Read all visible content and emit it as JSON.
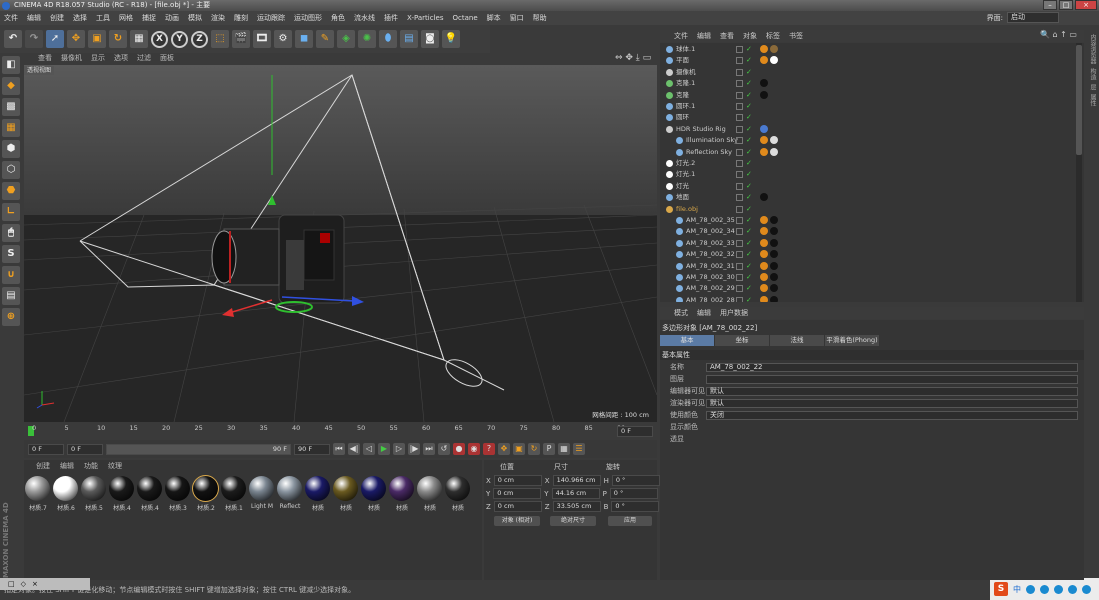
{
  "window": {
    "title": "CINEMA 4D R18.057 Studio (RC - R18) - [file.obj *] - 主要"
  },
  "menu": [
    "文件",
    "编辑",
    "创建",
    "选择",
    "工具",
    "网格",
    "捕捉",
    "动画",
    "模拟",
    "渲染",
    "雕刻",
    "运动跟踪",
    "运动图形",
    "角色",
    "流水线",
    "插件",
    "X-Particles",
    "Octane",
    "脚本",
    "窗口",
    "帮助"
  ],
  "layout": {
    "label": "界面:",
    "value": "启动"
  },
  "viewport": {
    "menu": [
      "查看",
      "摄像机",
      "显示",
      "选项",
      "过滤",
      "面板"
    ],
    "label": "透视视图",
    "grid_info": "网格间距 : 100 cm"
  },
  "timeline": {
    "ticks": [
      "0",
      "5",
      "10",
      "15",
      "20",
      "25",
      "30",
      "35",
      "40",
      "45",
      "50",
      "55",
      "60",
      "65",
      "70",
      "75",
      "80",
      "85",
      "90"
    ],
    "end_field": "0 F"
  },
  "playback": {
    "start": "0 F",
    "current": "0 F",
    "range_end": "90 F",
    "end": "90 F"
  },
  "materials": {
    "menu": [
      "创建",
      "编辑",
      "功能",
      "纹理"
    ],
    "items": [
      {
        "label": "材质.7",
        "color": "#9a9a9a"
      },
      {
        "label": "材质.6",
        "color": "#ffffff"
      },
      {
        "label": "材质.5",
        "color": "#5a5a5a"
      },
      {
        "label": "材质.4",
        "color": "#1a1a1a"
      },
      {
        "label": "材质.4",
        "color": "#1a1a1a"
      },
      {
        "label": "材质.3",
        "color": "#161616"
      },
      {
        "label": "材质.2",
        "color": "#121212"
      },
      {
        "label": "材质.1",
        "color": "#1c1c1c"
      },
      {
        "label": "Light M",
        "color": "#7a8590"
      },
      {
        "label": "Reflect",
        "color": "#8a95a0"
      },
      {
        "label": "材质",
        "color": "#1a1a66"
      },
      {
        "label": "材质",
        "color": "#6a5a20"
      },
      {
        "label": "材质",
        "color": "#1a1a66"
      },
      {
        "label": "材质",
        "color": "#4a2a66"
      },
      {
        "label": "材质",
        "color": "#8a8a8a"
      },
      {
        "label": "材质",
        "color": "#2e2e2e"
      }
    ]
  },
  "coords": {
    "headers": [
      "位置",
      "尺寸",
      "旋转"
    ],
    "rows": [
      {
        "axis": "X",
        "pos": "0 cm",
        "size": "140.966 cm",
        "rl": "H",
        "rot": "0 °"
      },
      {
        "axis": "Y",
        "pos": "0 cm",
        "size": "44.16 cm",
        "rl": "P",
        "rot": "0 °"
      },
      {
        "axis": "Z",
        "pos": "0 cm",
        "size": "33.505 cm",
        "rl": "B",
        "rot": "0 °"
      }
    ],
    "mode1": "对象 (相对)",
    "mode2": "绝对尺寸",
    "apply": "应用"
  },
  "object_manager": {
    "menu": [
      "文件",
      "编辑",
      "查看",
      "对象",
      "标签",
      "书签"
    ],
    "objects": [
      {
        "name": "球体.1",
        "color": "#7fb0e0",
        "tags": [
          "#e08a1c",
          "#8a6a3a"
        ]
      },
      {
        "name": "平面",
        "color": "#7fb0e0",
        "tags": [
          "#e08a1c",
          "#ffffff"
        ]
      },
      {
        "name": "摄像机",
        "color": "#cccccc",
        "tags": []
      },
      {
        "name": "克隆.1",
        "color": "#6cc06c",
        "tags": [
          "#111111"
        ]
      },
      {
        "name": "克隆",
        "color": "#6cc06c",
        "tags": [
          "#111111"
        ]
      },
      {
        "name": "圆环.1",
        "color": "#7fb0e0",
        "tags": []
      },
      {
        "name": "圆环",
        "color": "#7fb0e0",
        "tags": []
      },
      {
        "name": "HDR Studio Rig",
        "color": "#cccccc",
        "tags": [
          "#4a7ad0"
        ]
      },
      {
        "name": "Illumination Sky",
        "color": "#7fb0e0",
        "tags": [
          "#e08a1c",
          "#dddddd"
        ]
      },
      {
        "name": "Reflection Sky",
        "color": "#7fb0e0",
        "tags": [
          "#e08a1c",
          "#dddddd"
        ]
      },
      {
        "name": "灯光.2",
        "color": "#ffffff",
        "tags": []
      },
      {
        "name": "灯光.1",
        "color": "#ffffff",
        "tags": []
      },
      {
        "name": "灯光",
        "color": "#ffffff",
        "tags": []
      },
      {
        "name": "地面",
        "color": "#7fb0e0",
        "tags": [
          "#111111"
        ]
      },
      {
        "name": "file.obj",
        "color": "#d9a84a",
        "tags": []
      },
      {
        "name": "AM_78_002_35",
        "color": "#7fb0e0",
        "tags": [
          "#e08a1c",
          "#111111"
        ]
      },
      {
        "name": "AM_78_002_34",
        "color": "#7fb0e0",
        "tags": [
          "#e08a1c",
          "#111111"
        ]
      },
      {
        "name": "AM_78_002_33",
        "color": "#7fb0e0",
        "tags": [
          "#e08a1c",
          "#111111"
        ]
      },
      {
        "name": "AM_78_002_32",
        "color": "#7fb0e0",
        "tags": [
          "#e08a1c",
          "#111111"
        ]
      },
      {
        "name": "AM_78_002_31",
        "color": "#7fb0e0",
        "tags": [
          "#e08a1c",
          "#111111"
        ]
      },
      {
        "name": "AM_78_002_30",
        "color": "#7fb0e0",
        "tags": [
          "#e08a1c",
          "#111111"
        ]
      },
      {
        "name": "AM_78_002_29",
        "color": "#7fb0e0",
        "tags": [
          "#e08a1c",
          "#111111"
        ]
      },
      {
        "name": "AM_78_002_28",
        "color": "#7fb0e0",
        "tags": [
          "#e08a1c",
          "#111111"
        ]
      }
    ]
  },
  "attributes": {
    "menu": [
      "模式",
      "编辑",
      "用户数据"
    ],
    "title": "多边形对象 [AM_78_002_22]",
    "tabs": [
      "基本",
      "坐标",
      "法线",
      "平滑着色(Phong)"
    ],
    "section": "基本属性",
    "fields": [
      {
        "label": "名称",
        "value": "AM_78_002_22"
      },
      {
        "label": "图层",
        "value": ""
      },
      {
        "label": "编辑器可见",
        "value": "默认"
      },
      {
        "label": "渲染器可见",
        "value": "默认"
      },
      {
        "label": "使用颜色",
        "value": "关闭"
      },
      {
        "label": "显示颜色",
        "value": ""
      },
      {
        "label": "透显",
        "value": ""
      }
    ]
  },
  "right_strip": [
    "内容浏览器",
    "构造",
    "层",
    "属性"
  ],
  "status": {
    "text": "指定对象。按住 SHIFT 键是化移动；节点编辑模式时按住 SHIFT 键增加选择对象；按住 CTRL 键减少选择对象。"
  },
  "tray": {
    "ime": "中",
    "time": ""
  },
  "mini_window": [
    "□",
    "◇",
    "×"
  ]
}
